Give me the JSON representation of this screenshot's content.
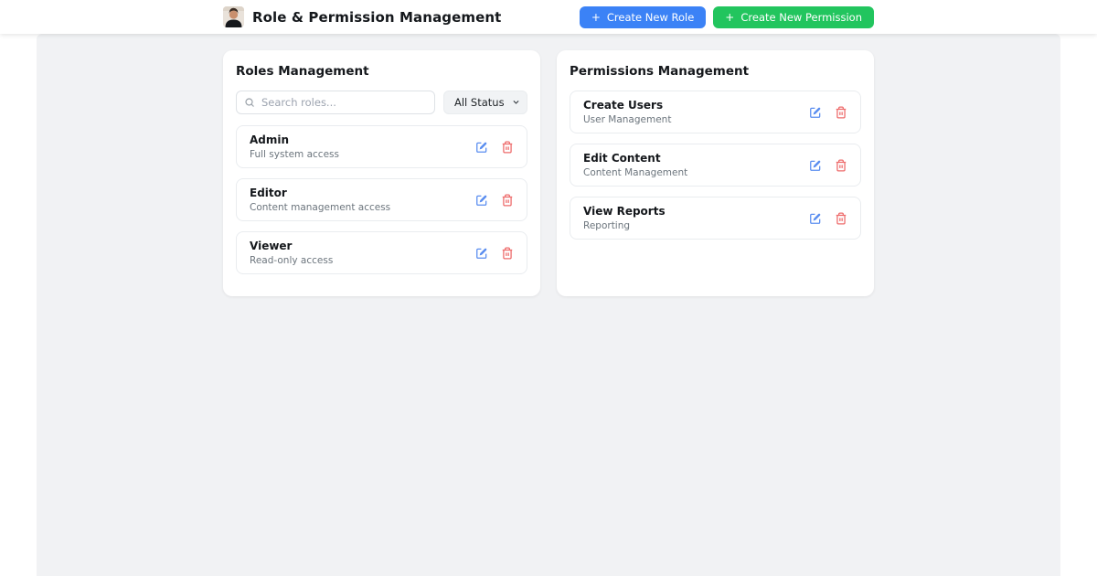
{
  "header": {
    "title": "Role & Permission Management",
    "buttons": [
      {
        "label": "Create New Role",
        "icon": "+"
      },
      {
        "label": "Create New Permission",
        "icon": "+"
      }
    ]
  },
  "roles_card": {
    "title": "Roles Management",
    "search_placeholder": "Search roles...",
    "status_filter_selected": "All Status",
    "roles": [
      {
        "name": "Admin",
        "description": "Full system access"
      },
      {
        "name": "Editor",
        "description": "Content management access"
      },
      {
        "name": "Viewer",
        "description": "Read-only access"
      }
    ]
  },
  "permissions_card": {
    "title": "Permissions Management",
    "permissions": [
      {
        "name": "Create Users",
        "category": "User Management"
      },
      {
        "name": "Edit Content",
        "category": "Content Management"
      },
      {
        "name": "View Reports",
        "category": "Reporting"
      }
    ]
  },
  "colors": {
    "primary_blue": "#3b82f6",
    "success_green": "#22c55e",
    "edit_icon": "#5b8ef0",
    "delete_icon": "#ee6b6b",
    "panel_gray": "#f1f2f4"
  }
}
